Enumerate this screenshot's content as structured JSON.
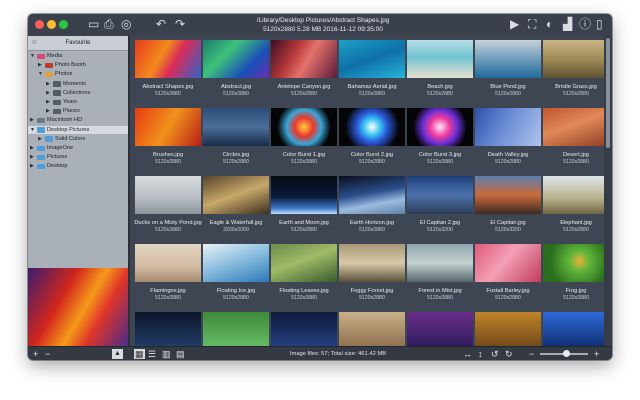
{
  "window": {
    "path": "/Library/Desktop Pictures/Abstract Shapes.jpg",
    "info": "5120x2880  5.28 MB  2016-11-12 09:35:00",
    "traffic_lights": [
      "#fc5f57",
      "#fdbc2e",
      "#28c840"
    ]
  },
  "toolbar_left": [
    {
      "name": "folder-icon",
      "glyph": "▭"
    },
    {
      "name": "print-icon",
      "glyph": "⎙"
    },
    {
      "name": "share-icon",
      "glyph": "◎"
    },
    {
      "name": "rotate-left-icon",
      "glyph": "↶"
    },
    {
      "name": "rotate-right-icon",
      "glyph": "↷"
    }
  ],
  "toolbar_right": [
    {
      "name": "play-icon",
      "glyph": "▶"
    },
    {
      "name": "fullscreen-icon",
      "glyph": "⛶"
    },
    {
      "name": "color-icon",
      "glyph": "◐"
    },
    {
      "name": "histogram-icon",
      "glyph": "▟"
    },
    {
      "name": "info-icon",
      "glyph": "ⓘ"
    },
    {
      "name": "panel-icon",
      "glyph": "▯"
    }
  ],
  "sidebar": {
    "header": "Favourite",
    "items": [
      {
        "label": "Media",
        "level": 0,
        "expanded": true,
        "color": "#d44a7a"
      },
      {
        "label": "Photo Booth",
        "level": 1,
        "expanded": false,
        "color": "#c0392b"
      },
      {
        "label": "Photos",
        "level": 1,
        "expanded": true,
        "color": "#e0a33a"
      },
      {
        "label": "Moments",
        "level": 2,
        "expanded": false,
        "color": "#555b63"
      },
      {
        "label": "Collections",
        "level": 2,
        "expanded": false,
        "color": "#555b63"
      },
      {
        "label": "Years",
        "level": 2,
        "expanded": false,
        "color": "#555b63"
      },
      {
        "label": "Places",
        "level": 2,
        "expanded": false,
        "color": "#555b63"
      },
      {
        "label": "Macintosh HD",
        "level": 0,
        "expanded": false,
        "color": "#6f7780"
      },
      {
        "label": "Desktop Pictures",
        "level": 0,
        "expanded": true,
        "selected": true,
        "color": "#4f9cdb"
      },
      {
        "label": "Solid Colors",
        "level": 1,
        "expanded": false,
        "color": "#4f9cdb"
      },
      {
        "label": "ImageOne",
        "level": 0,
        "expanded": false,
        "color": "#4f9cdb"
      },
      {
        "label": "Pictures",
        "level": 0,
        "expanded": false,
        "color": "#4f9cdb"
      },
      {
        "label": "Desktop",
        "level": 0,
        "expanded": false,
        "color": "#4f9cdb"
      }
    ]
  },
  "images": [
    {
      "name": "Abstract Shapes.jpg",
      "dims": "5120x2880",
      "bg": "linear-gradient(120deg,#e53a1c 0%,#f28a1d 40%,#d92b5a 60%,#2e63c9 100%)"
    },
    {
      "name": "Abstract.jpg",
      "dims": "5120x2880",
      "bg": "linear-gradient(135deg,#1b7b6b 0%,#3ec27a 35%,#1a4fb8 70%,#6a2fb0 100%)"
    },
    {
      "name": "Antelope Canyon.jpg",
      "dims": "5120x2880",
      "bg": "linear-gradient(120deg,#3b0e24 0%,#b6393b 35%,#e4726a 55%,#5a1a3a 100%)"
    },
    {
      "name": "Bahamas Aerial.jpg",
      "dims": "5120x2880",
      "bg": "linear-gradient(160deg,#1ca1c7 0%,#0f6fa8 50%,#27b4d8 100%)"
    },
    {
      "name": "Beach.jpg",
      "dims": "5120x2880",
      "bg": "linear-gradient(180deg,#b9dfe8 0%,#6fc3cf 45%,#e7e0cf 100%)"
    },
    {
      "name": "Blue Pond.jpg",
      "dims": "5120x2880",
      "bg": "linear-gradient(180deg,#c8d2db 0%,#7fa6c2 40%,#1f6a9a 100%)"
    },
    {
      "name": "Bristle Grass.jpg",
      "dims": "5120x2880",
      "bg": "linear-gradient(180deg,#c9b487 0%,#a08b55 50%,#5d5232 100%)"
    },
    {
      "name": "Brushes.jpg",
      "dims": "5120x2880",
      "bg": "linear-gradient(120deg,#e63b12 0%,#f0921c 50%,#b81f16 100%)"
    },
    {
      "name": "Circles.jpg",
      "dims": "5120x2880",
      "bg": "linear-gradient(180deg,#2b4c78 0%,#4b6e99 50%,#1a2c48 100%)"
    },
    {
      "name": "Color Burst 1.jpg",
      "dims": "5120x2880",
      "bg": "radial-gradient(circle,#ffcf3a 0%,#e8362f 25%,#3aa6d6 45%,#050508 70%)"
    },
    {
      "name": "Color Burst 2.jpg",
      "dims": "5120x2880",
      "bg": "radial-gradient(circle,#ffffff 0%,#37c2f0 22%,#2a58d8 40%,#050508 70%)"
    },
    {
      "name": "Color Burst 3.jpg",
      "dims": "5120x2880",
      "bg": "radial-gradient(circle,#fbe7ff 0%,#f03c9c 25%,#6b2fd8 45%,#050508 70%)"
    },
    {
      "name": "Death Valley.jpg",
      "dims": "5120x2880",
      "bg": "linear-gradient(120deg,#2f4fa8 0%,#6a8cd6 45%,#b0c4ec 100%)"
    },
    {
      "name": "Desert.jpg",
      "dims": "5120x2880",
      "bg": "linear-gradient(160deg,#c0552e 0%,#e08a58 45%,#8e3b23 100%)"
    },
    {
      "name": "Ducks on a Misty Pond.jpg",
      "dims": "5120x2880",
      "bg": "linear-gradient(180deg,#d9dcdf 0%,#b6bcc2 60%,#8c949c 100%)"
    },
    {
      "name": "Eagle & Waterfall.jpg",
      "dims": "3200x2000",
      "bg": "linear-gradient(160deg,#56432a 0%,#c8a86a 50%,#3b2f1e 100%)"
    },
    {
      "name": "Earth and Moon.jpg",
      "dims": "5120x2880",
      "bg": "linear-gradient(180deg,#050914 0%,#0b1a3a 55%,#3f78c8 85%,#bfe0ff 100%)"
    },
    {
      "name": "Earth Horizon.jpg",
      "dims": "5120x2880",
      "bg": "linear-gradient(170deg,#0a0f1c 0%,#2b4f8c 45%,#9bbbe0 70%,#5f7fa4 100%)"
    },
    {
      "name": "El Capitan 2.jpg",
      "dims": "5120x3200",
      "bg": "linear-gradient(180deg,#1c3f7a 0%,#4d72ad 50%,#2a3d55 100%)"
    },
    {
      "name": "El Capitan.jpg",
      "dims": "5120x3200",
      "bg": "linear-gradient(180deg,#5c7fb0 0%,#c86a3a 50%,#3a2b22 100%)"
    },
    {
      "name": "Elephant.jpg",
      "dims": "5120x2880",
      "bg": "linear-gradient(180deg,#dfe6e8 0%,#b8b08a 60%,#6f6545 100%)"
    },
    {
      "name": "Flamingos.jpg",
      "dims": "5120x2880",
      "bg": "linear-gradient(180deg,#e2d6c2 0%,#d3b9a0 60%,#a48b70 100%)"
    },
    {
      "name": "Floating Ice.jpg",
      "dims": "5120x2880",
      "bg": "linear-gradient(160deg,#e8f1f7 0%,#8fc0e0 45%,#2b78b8 100%)"
    },
    {
      "name": "Floating Leaves.jpg",
      "dims": "5120x2880",
      "bg": "linear-gradient(160deg,#6c8a4a 0%,#9fbc68 45%,#3a5a2c 100%)"
    },
    {
      "name": "Foggy Forest.jpg",
      "dims": "5120x2880",
      "bg": "linear-gradient(180deg,#a89878 0%,#d8caa8 50%,#5a5038 100%)"
    },
    {
      "name": "Forest in Mist.jpg",
      "dims": "5120x2880",
      "bg": "linear-gradient(180deg,#8fa6b0 0%,#c6d2cf 50%,#56676a 100%)"
    },
    {
      "name": "Foxtail Barley.jpg",
      "dims": "5120x2880",
      "bg": "linear-gradient(130deg,#e05a7a 0%,#f3a0b6 45%,#c23a5c 100%)"
    },
    {
      "name": "Frog.jpg",
      "dims": "5120x2880",
      "bg": "radial-gradient(circle at 55% 45%,#e8b23a 0%,#5fb53a 25%,#2a6e1e 70%)"
    },
    {
      "name": "",
      "dims": "",
      "bg": "linear-gradient(180deg,#0c1528 0%,#23416e 100%)"
    },
    {
      "name": "",
      "dims": "",
      "bg": "linear-gradient(180deg,#3d8a3a 0%,#6bc06a 100%)"
    },
    {
      "name": "",
      "dims": "",
      "bg": "linear-gradient(180deg,#0d1a3a 0%,#27448a 100%)"
    },
    {
      "name": "",
      "dims": "",
      "bg": "linear-gradient(180deg,#c9b08a 0%,#8a6a4a 100%)"
    },
    {
      "name": "",
      "dims": "",
      "bg": "linear-gradient(180deg,#6a2e8a 0%,#2a1a5a 100%)"
    },
    {
      "name": "",
      "dims": "",
      "bg": "linear-gradient(180deg,#c0842a 0%,#6a4418 100%)"
    },
    {
      "name": "",
      "dims": "",
      "bg": "linear-gradient(180deg,#2e6ad8 0%,#0e2a6a 100%)"
    }
  ],
  "status": {
    "text": "Image files: 57;  Total size: 461.42 MB"
  },
  "bottom_left": [
    {
      "name": "add-icon",
      "glyph": "+"
    },
    {
      "name": "remove-icon",
      "glyph": "−"
    },
    {
      "name": "eject-icon",
      "glyph": "▲"
    }
  ],
  "view_modes": [
    {
      "name": "grid-view-icon",
      "glyph": "▦"
    },
    {
      "name": "list-view-icon",
      "glyph": "☰"
    },
    {
      "name": "filmstrip-view-icon",
      "glyph": "▥"
    },
    {
      "name": "details-view-icon",
      "glyph": "▤"
    }
  ],
  "bottom_right": [
    {
      "name": "fit-width-icon",
      "glyph": "↔"
    },
    {
      "name": "fit-height-icon",
      "glyph": "↕"
    },
    {
      "name": "rotate-ccw-icon",
      "glyph": "↺"
    },
    {
      "name": "rotate-cw-icon",
      "glyph": "↻"
    },
    {
      "name": "zoom-out-icon",
      "glyph": "−"
    },
    {
      "name": "zoom-in-icon",
      "glyph": "+"
    }
  ],
  "zoom_level": 0.55
}
